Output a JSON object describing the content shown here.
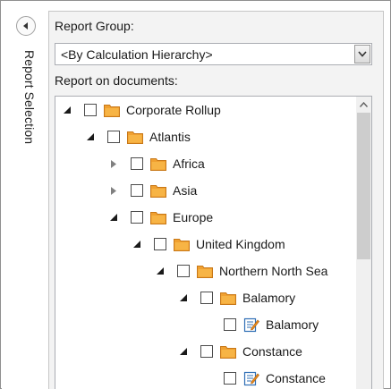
{
  "sidebar": {
    "title": "Report Selection",
    "collapse_icon": "chevron-left-icon"
  },
  "report_group": {
    "label": "Report Group:",
    "selected": "<By Calculation Hierarchy>"
  },
  "documents": {
    "label": "Report on documents:",
    "tree": [
      {
        "label": "Corporate Rollup",
        "level": 0,
        "expander": "expanded",
        "icon": "folder-icon",
        "checked": false
      },
      {
        "label": "Atlantis",
        "level": 1,
        "expander": "expanded",
        "icon": "folder-icon",
        "checked": false
      },
      {
        "label": "Africa",
        "level": 2,
        "expander": "collapsed",
        "icon": "folder-icon",
        "checked": false
      },
      {
        "label": "Asia",
        "level": 2,
        "expander": "collapsed",
        "icon": "folder-icon",
        "checked": false
      },
      {
        "label": "Europe",
        "level": 2,
        "expander": "expanded",
        "icon": "folder-icon",
        "checked": false
      },
      {
        "label": "United Kingdom",
        "level": 3,
        "expander": "expanded",
        "icon": "folder-icon",
        "checked": false
      },
      {
        "label": "Northern North Sea",
        "level": 4,
        "expander": "expanded",
        "icon": "folder-icon",
        "checked": false
      },
      {
        "label": "Balamory",
        "level": 5,
        "expander": "expanded",
        "icon": "folder-icon",
        "checked": false
      },
      {
        "label": "Balamory",
        "level": 6,
        "expander": "none",
        "icon": "document-edit-icon",
        "checked": false
      },
      {
        "label": "Constance",
        "level": 5,
        "expander": "expanded",
        "icon": "folder-icon",
        "checked": false
      },
      {
        "label": "Constance",
        "level": 6,
        "expander": "none",
        "icon": "document-edit-icon",
        "checked": false
      }
    ]
  },
  "colors": {
    "folder": "#f0a030",
    "folder_dark": "#c87818",
    "document_blue": "#2f6fb5",
    "scroll_thumb": "#cdcdcd",
    "panel_bg": "#f3f3f3"
  }
}
